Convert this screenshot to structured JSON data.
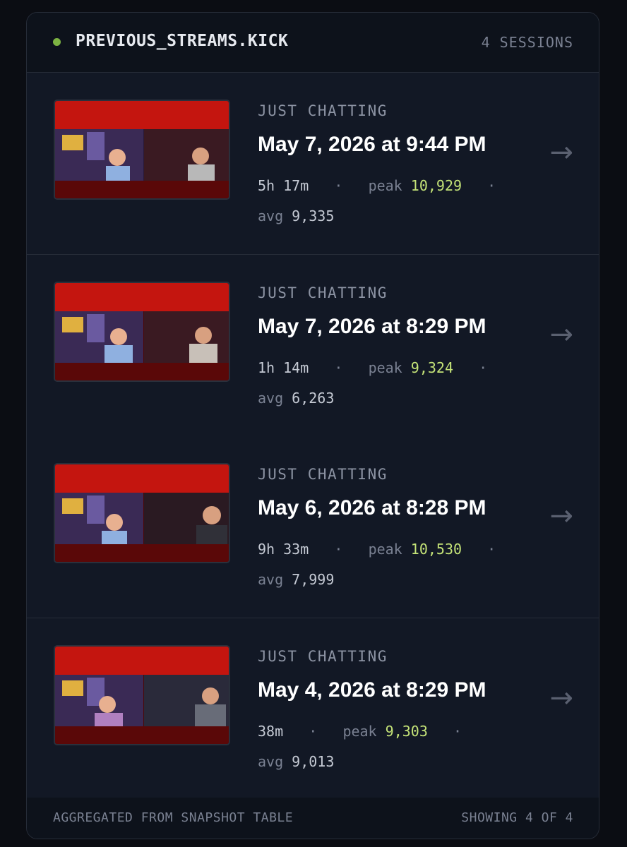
{
  "header": {
    "title": "PREVIOUS_STREAMS.KICK",
    "session_count": "4 SESSIONS",
    "status_color": "#7cb342"
  },
  "sessions": [
    {
      "category": "JUST CHATTING",
      "started": "May 7, 2026 at 9:44 PM",
      "duration": "5h 17m",
      "peak_label": "peak",
      "peak": "10,929",
      "avg_label": "avg",
      "avg": "9,335",
      "thumbnail_icon": "stream-thumbnail"
    },
    {
      "category": "JUST CHATTING",
      "started": "May 7, 2026 at 8:29 PM",
      "duration": "1h 14m",
      "peak_label": "peak",
      "peak": "9,324",
      "avg_label": "avg",
      "avg": "6,263",
      "thumbnail_icon": "stream-thumbnail"
    },
    {
      "category": "JUST CHATTING",
      "started": "May 6, 2026 at 8:28 PM",
      "duration": "9h 33m",
      "peak_label": "peak",
      "peak": "10,530",
      "avg_label": "avg",
      "avg": "7,999",
      "thumbnail_icon": "stream-thumbnail"
    },
    {
      "category": "JUST CHATTING",
      "started": "May 4, 2026 at 8:29 PM",
      "duration": "38m",
      "peak_label": "peak",
      "peak": "9,303",
      "avg_label": "avg",
      "avg": "9,013",
      "thumbnail_icon": "stream-thumbnail"
    }
  ],
  "footer": {
    "source": "AGGREGATED FROM SNAPSHOT TABLE",
    "showing": "SHOWING 4 OF 4"
  },
  "colors": {
    "background": "#0b0d13",
    "panel": "#101520",
    "accent_peak": "#c5e478",
    "muted": "#7a8192"
  }
}
